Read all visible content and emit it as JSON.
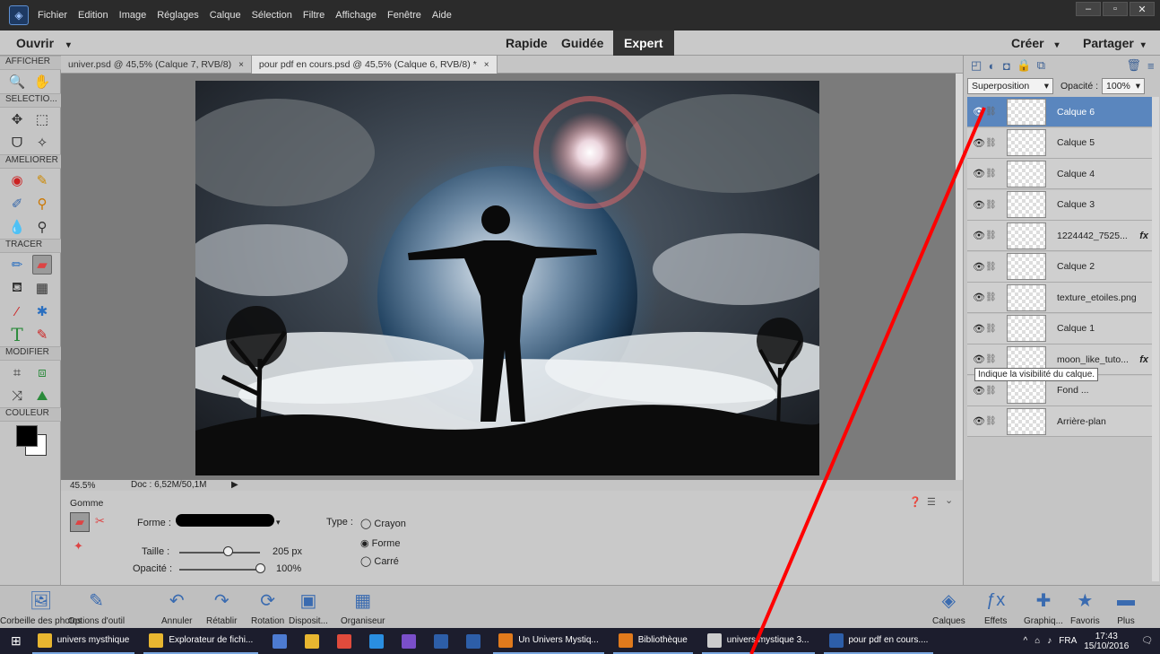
{
  "menubar": {
    "items": [
      "Fichier",
      "Edition",
      "Image",
      "Réglages",
      "Calque",
      "Sélection",
      "Filtre",
      "Affichage",
      "Fenêtre",
      "Aide"
    ],
    "window_controls": [
      "–",
      "▫",
      "✕"
    ]
  },
  "modebar": {
    "open_label": "Ouvrir",
    "modes": [
      "Rapide",
      "Guidée",
      "Expert"
    ],
    "active_mode": "Expert",
    "create_label": "Créer",
    "share_label": "Partager"
  },
  "toolbox": {
    "sections": [
      "AFFICHER",
      "SELECTIO...",
      "AMELIORER",
      "TRACER",
      "MODIFIER",
      "COULEUR"
    ]
  },
  "tabs": [
    {
      "label": "univer.psd @ 45,5% (Calque 7, RVB/8)",
      "close": "×"
    },
    {
      "label": "pour pdf en cours.psd @ 45,5% (Calque 6, RVB/8) *",
      "close": "×"
    }
  ],
  "status": {
    "zoom": "45.5%",
    "doc": "Doc : 6,52M/50,1M"
  },
  "options": {
    "tool_name": "Gomme",
    "forme_label": "Forme :",
    "taille_label": "Taille :",
    "taille_value": "205 px",
    "taille_level": 0.6,
    "opacite_label": "Opacité :",
    "opacite_value": "100%",
    "opacite_level": 1.0,
    "type_label": "Type :",
    "type_options": [
      "Crayon",
      "Forme",
      "Carré"
    ],
    "type_selected": "Forme"
  },
  "layers_panel": {
    "blend_mode": "Superposition",
    "opacity_label": "Opacité :",
    "opacity_value": "100%",
    "layers": [
      {
        "name": "Calque 6",
        "selected": true,
        "fx": ""
      },
      {
        "name": "Calque 5",
        "selected": false,
        "fx": ""
      },
      {
        "name": "Calque 4",
        "selected": false,
        "fx": ""
      },
      {
        "name": "Calque 3",
        "selected": false,
        "fx": ""
      },
      {
        "name": "1224442_7525...",
        "selected": false,
        "fx": "fx"
      },
      {
        "name": "Calque 2",
        "selected": false,
        "fx": ""
      },
      {
        "name": "texture_etoiles.png",
        "selected": false,
        "fx": ""
      },
      {
        "name": "Calque 1",
        "selected": false,
        "fx": ""
      },
      {
        "name": "moon_like_tuto...",
        "selected": false,
        "fx": "fx"
      },
      {
        "name": "Fond ...",
        "selected": false,
        "fx": ""
      },
      {
        "name": "Arrière-plan",
        "selected": false,
        "fx": ""
      }
    ],
    "tooltip": "Indique la visibilité du calque."
  },
  "bottombar": [
    {
      "label": "Corbeille des photos",
      "icon": "photo-bin-icon"
    },
    {
      "label": "Options d'outil",
      "icon": "tool-options-icon"
    },
    {
      "label": "Annuler",
      "icon": "undo-icon"
    },
    {
      "label": "Rétablir",
      "icon": "redo-icon"
    },
    {
      "label": "Rotation",
      "icon": "rotate-icon"
    },
    {
      "label": "Disposit...",
      "icon": "layout-icon"
    },
    {
      "label": "Organiseur",
      "icon": "organizer-icon"
    },
    {
      "label": "Calques",
      "icon": "layers-icon"
    },
    {
      "label": "Effets",
      "icon": "effects-icon"
    },
    {
      "label": "Graphiq...",
      "icon": "graphics-icon"
    },
    {
      "label": "Favoris",
      "icon": "favorites-icon"
    },
    {
      "label": "Plus",
      "icon": "more-icon"
    }
  ],
  "taskbar": {
    "items": [
      {
        "label": "univers mysthique",
        "color": "#e8b630"
      },
      {
        "label": "Explorateur de fichi...",
        "color": "#e8b630"
      },
      {
        "label": "",
        "color": "#4d7bd1"
      },
      {
        "label": "",
        "color": "#e8b630"
      },
      {
        "label": "",
        "color": "#e04b3c"
      },
      {
        "label": "",
        "color": "#2a8ee0"
      },
      {
        "label": "",
        "color": "#7a4fc9"
      },
      {
        "label": "",
        "color": "#2d5ea8"
      },
      {
        "label": "",
        "color": "#2d5ea8"
      },
      {
        "label": "Un Univers Mystiq...",
        "color": "#e07a1c"
      },
      {
        "label": "Bibliothèque",
        "color": "#e07a1c"
      },
      {
        "label": "univers mystique 3...",
        "color": "#cccccc"
      },
      {
        "label": "pour pdf en cours....",
        "color": "#2d5ea8"
      }
    ],
    "lang": "FRA",
    "time": "17:43",
    "date": "15/10/2016"
  }
}
